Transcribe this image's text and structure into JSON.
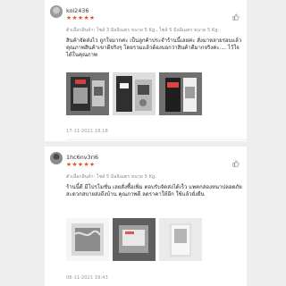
{
  "reviews": [
    {
      "username": "koi2436",
      "stars": "★★★★★",
      "variant": "ตัวเลือกสินค้า: ไซส์ 3 มิลลิเมตร ขนาด 5 Kg., ไซส์ 5 มิลลิเมตร ขนาด 5 Kg.",
      "text": "สินค้าจัดส่งไว ถูกใจมากค่ะ เป็นลูกค้าประจำร้านนี้เลยค่ะ สั่งมาหลายรอบแล้วคุณภาพสินค้าเขาดีจริงๆ โดยรวมแล้วต้องบอกว่าสินค้าดีมากจริงค่ะ.... ไว้ใจได้ในคุณภาพ",
      "time": "17-11-2021 18:18"
    },
    {
      "username": "1hc6nv3ri6",
      "stars": "★★★★★",
      "variant": "ตัวเลือกสินค้า: ไซส์ 5 มิลลิเมตร ขนาด 5 Kg.",
      "text": "ร้านนี้ดี มีโปรโมชั่น เลยสั่งซื้อเพิ่ม ตอบรับจัดส่งได้เร็ว แพคกล่องหนาปลอดภัย สะดวกสบายส่งถึงบ้าน คุณภาพดี ลดราคาให้อีก ใช้แล้วยั่งยืน",
      "time": "08-11-2021 19:43"
    }
  ],
  "icons": {
    "like": "thumbs-up-icon",
    "more": "more-icon"
  },
  "colors": {
    "star": "#ee4d2d",
    "muted": "#9a9a9a"
  }
}
